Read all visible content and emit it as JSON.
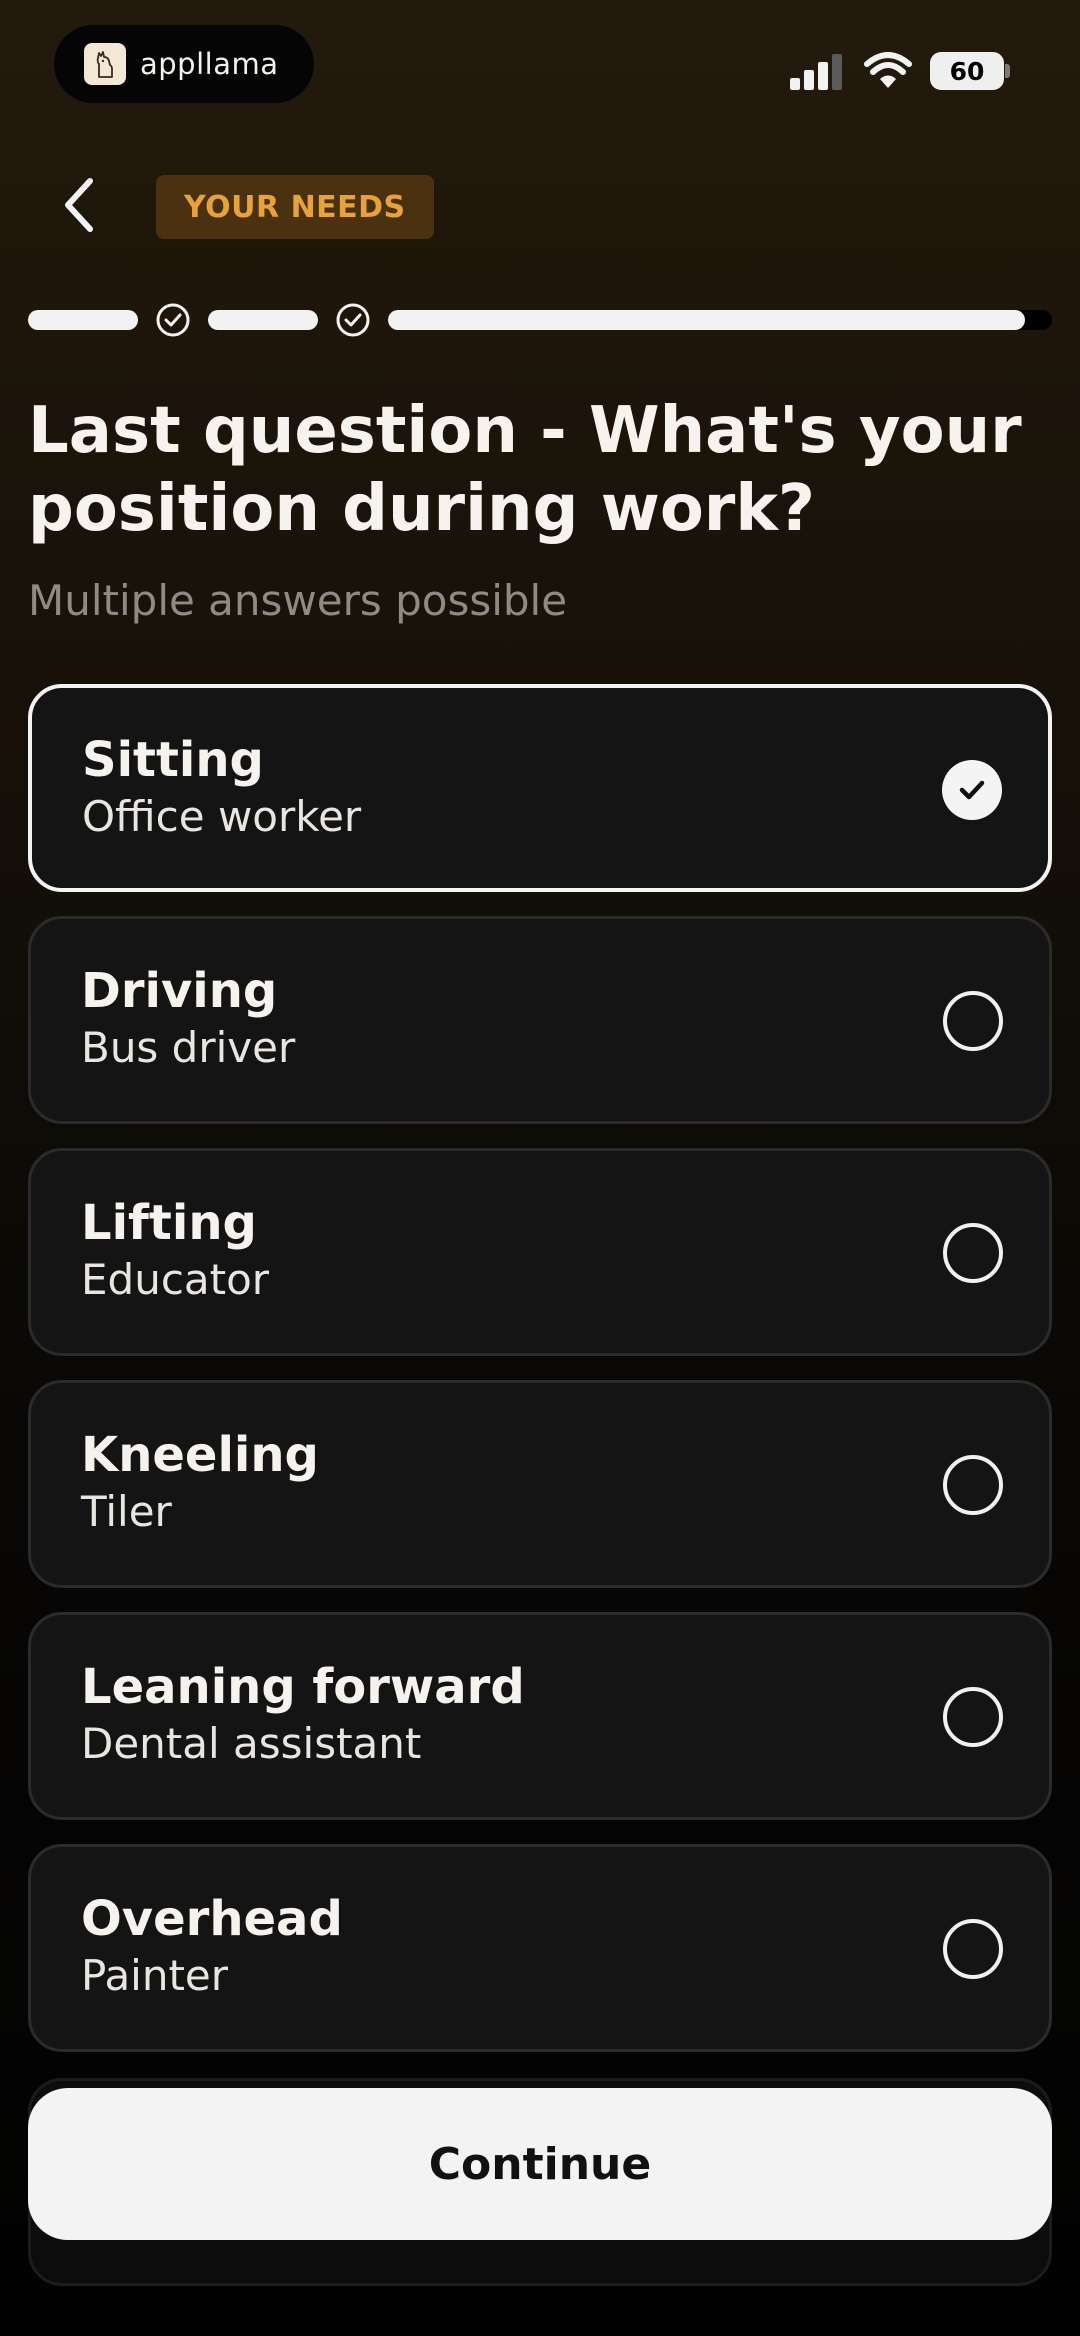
{
  "status_bar": {
    "app_name": "appllama",
    "battery": "60",
    "signal_icon": "signal-icon",
    "wifi_icon": "wifi-icon"
  },
  "header": {
    "back_icon": "chevron-left-icon",
    "badge": "YOUR NEEDS"
  },
  "progress": {
    "completed_steps": 2,
    "current_step_fraction": 0.96
  },
  "question": {
    "title": "Last question - What's your position during work?",
    "subtitle": "Multiple answers possible"
  },
  "options": [
    {
      "title": "Sitting",
      "subtitle": "Office worker",
      "selected": true
    },
    {
      "title": "Driving",
      "subtitle": "Bus driver",
      "selected": false
    },
    {
      "title": "Lifting",
      "subtitle": "Educator",
      "selected": false
    },
    {
      "title": "Kneeling",
      "subtitle": "Tiler",
      "selected": false
    },
    {
      "title": "Leaning forward",
      "subtitle": "Dental assistant",
      "selected": false
    },
    {
      "title": "Overhead",
      "subtitle": "Painter",
      "selected": false
    }
  ],
  "continue_label": "Continue",
  "colors": {
    "accent": "#e8a23a",
    "badge_bg": "#4a3210",
    "card_bg": "#141414",
    "button_bg": "#f3f3f3"
  }
}
